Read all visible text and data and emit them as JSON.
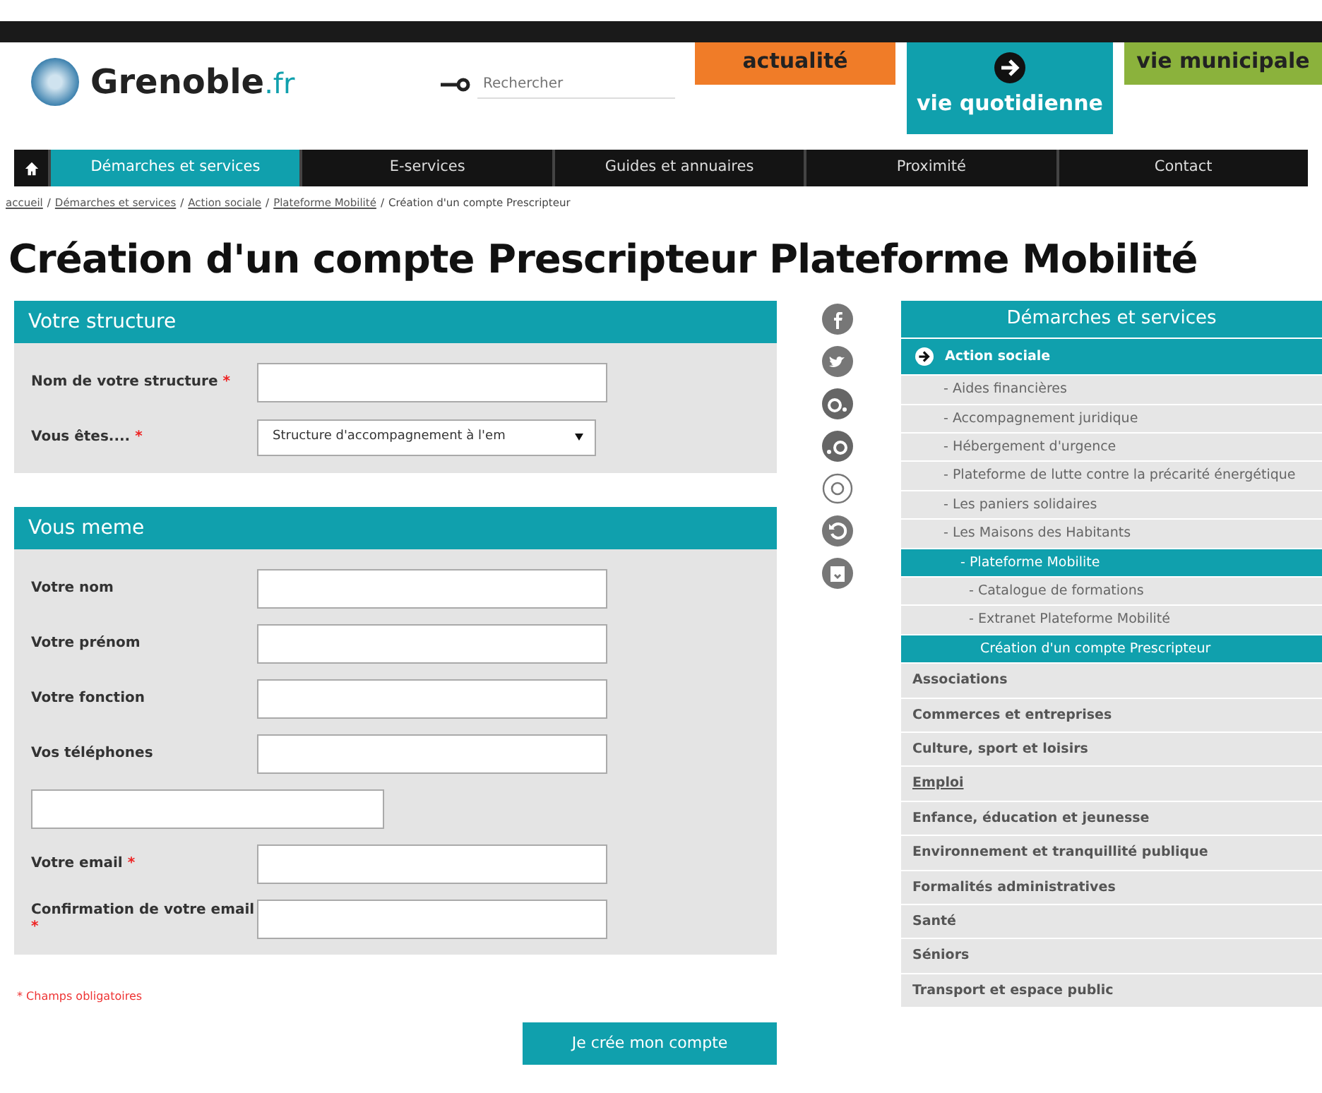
{
  "header": {
    "logo": {
      "name": "Grenoble",
      "suffix": ".fr"
    },
    "search": {
      "placeholder": "Rechercher"
    },
    "sections": [
      {
        "label": "actualité",
        "color": "#f07c28",
        "selected": false
      },
      {
        "label": "vie quotidienne",
        "color": "#10a0ad",
        "selected": true
      },
      {
        "label": "vie municipale",
        "color": "#8bb23c",
        "selected": false
      }
    ]
  },
  "nav": [
    {
      "label": "Démarches et services",
      "selected": true
    },
    {
      "label": "E-services",
      "selected": false
    },
    {
      "label": "Guides et annuaires",
      "selected": false
    },
    {
      "label": "Proximité",
      "selected": false
    },
    {
      "label": "Contact",
      "selected": false
    }
  ],
  "breadcrumb": [
    {
      "label": "accueil",
      "link": true
    },
    {
      "label": "Démarches et services",
      "link": true
    },
    {
      "label": "Action sociale",
      "link": true
    },
    {
      "label": "Plateforme Mobilité",
      "link": true
    },
    {
      "label": "Création d'un compte Prescripteur",
      "link": false
    }
  ],
  "breadcrumb_separator": "/",
  "required_mark": "*",
  "title": "Création d'un compte Prescripteur Plateforme Mobilité",
  "form_sections": [
    {
      "title": "Votre structure",
      "fields": [
        {
          "kind": "text",
          "label": "Nom de votre structure",
          "required": true
        },
        {
          "kind": "select",
          "label": "Vous êtes....",
          "required": true,
          "value": "Structure d'accompagnement à l'em"
        }
      ]
    },
    {
      "title": "Vous meme",
      "fields": [
        {
          "kind": "text",
          "label": "Votre nom",
          "required": false
        },
        {
          "kind": "text",
          "label": "Votre prénom",
          "required": false
        },
        {
          "kind": "text",
          "label": "Votre fonction",
          "required": false
        },
        {
          "kind": "text",
          "label": "Vos téléphones",
          "required": false
        },
        {
          "kind": "extra"
        },
        {
          "kind": "text",
          "label": "Votre email",
          "required": true
        },
        {
          "kind": "text",
          "label": "Confirmation de votre email",
          "required": true
        }
      ]
    }
  ],
  "required_note": "* Champs obligatoires",
  "submit": "Je crée mon compte",
  "sidebar": {
    "title": "Démarches et services",
    "items": [
      {
        "label": "Action sociale",
        "selected": true,
        "underlined": false,
        "children": [
          {
            "label": "- Aides financières",
            "selected": false
          },
          {
            "label": "- Accompagnement juridique",
            "selected": false
          },
          {
            "label": "- Hébergement d'urgence",
            "selected": false
          },
          {
            "label": "- Plateforme de lutte contre la précarité énergétique",
            "selected": false
          },
          {
            "label": "- Les paniers solidaires",
            "selected": false
          },
          {
            "label": "- Les Maisons des Habitants",
            "selected": false
          },
          {
            "label": "- Plateforme Mobilite",
            "selected": true,
            "children": [
              {
                "label": "- Catalogue de formations",
                "selected": false
              },
              {
                "label": "- Extranet Plateforme Mobilité",
                "selected": false
              },
              {
                "label": "Création d'un compte Prescripteur",
                "selected": true
              }
            ]
          }
        ]
      },
      {
        "label": "Associations",
        "selected": false,
        "underlined": false
      },
      {
        "label": "Commerces et entreprises",
        "selected": false,
        "underlined": false
      },
      {
        "label": "Culture, sport et loisirs",
        "selected": false,
        "underlined": false
      },
      {
        "label": "Emploi",
        "selected": false,
        "underlined": true
      },
      {
        "label": "Enfance, éducation et jeunesse",
        "selected": false,
        "underlined": false
      },
      {
        "label": "Environnement et tranquillité publique",
        "selected": false,
        "underlined": false
      },
      {
        "label": "Formalités administratives",
        "selected": false,
        "underlined": false
      },
      {
        "label": "Santé",
        "selected": false,
        "underlined": false
      },
      {
        "label": "Séniors",
        "selected": false,
        "underlined": false
      },
      {
        "label": "Transport et espace public",
        "selected": false,
        "underlined": false
      }
    ]
  }
}
